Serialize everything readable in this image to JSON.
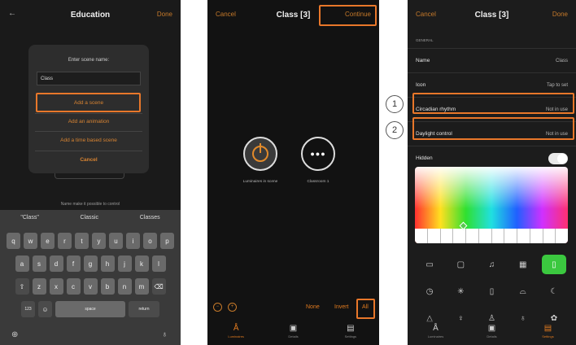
{
  "phone1": {
    "header": {
      "back_icon": "arrow-left-icon",
      "title": "Education",
      "done": "Done"
    },
    "dialog": {
      "title": "Enter scene name:",
      "input_value": "Class",
      "options": [
        "Add a scene",
        "Add an animation",
        "Add a time based scene",
        "Cancel"
      ]
    },
    "hint": "Name make it possible to control",
    "keyboard": {
      "suggestions": [
        "\"Class\"",
        "Classic",
        "Classes"
      ],
      "row1": [
        "q",
        "w",
        "e",
        "r",
        "t",
        "y",
        "u",
        "i",
        "o",
        "p"
      ],
      "row2": [
        "a",
        "s",
        "d",
        "f",
        "g",
        "h",
        "j",
        "k",
        "l"
      ],
      "row3": [
        "z",
        "x",
        "c",
        "v",
        "b",
        "n",
        "m"
      ],
      "space": "space",
      "return": "return",
      "numbers": "123"
    }
  },
  "phone2": {
    "header": {
      "cancel": "Cancel",
      "title": "Class [3]",
      "continue": "Continue"
    },
    "devices": [
      {
        "label": "Luminaires in scene"
      },
      {
        "label": "Classroom 1"
      }
    ],
    "selection": {
      "none": "None",
      "invert": "Invert",
      "all": "All"
    },
    "tabs": [
      {
        "label": "Luminaires",
        "icon": "luminaire-icon"
      },
      {
        "label": "Details",
        "icon": "details-icon"
      },
      {
        "label": "Settings",
        "icon": "settings-icon"
      }
    ]
  },
  "phone3": {
    "header": {
      "cancel": "Cancel",
      "title": "Class [3]",
      "done": "Done"
    },
    "section": "GENERAL",
    "rows": [
      {
        "label": "Name",
        "value": "Class"
      },
      {
        "label": "Icon",
        "value": "Tap to set"
      },
      {
        "label": "Circadian rhythm",
        "value": "Not in use"
      },
      {
        "label": "Daylight control",
        "value": "Not in use"
      },
      {
        "label": "Hidden",
        "value": ""
      }
    ],
    "hidden_toggle": "off",
    "tabs": [
      {
        "label": "Luminaires",
        "icon": "luminaire-icon"
      },
      {
        "label": "Details",
        "icon": "details-icon"
      },
      {
        "label": "Settings",
        "icon": "settings-icon"
      }
    ]
  },
  "callouts": [
    "1",
    "2"
  ],
  "colors": {
    "accent": "#e07a1f",
    "highlight": "#e8772a",
    "selected_icon": "#3bc83f"
  }
}
